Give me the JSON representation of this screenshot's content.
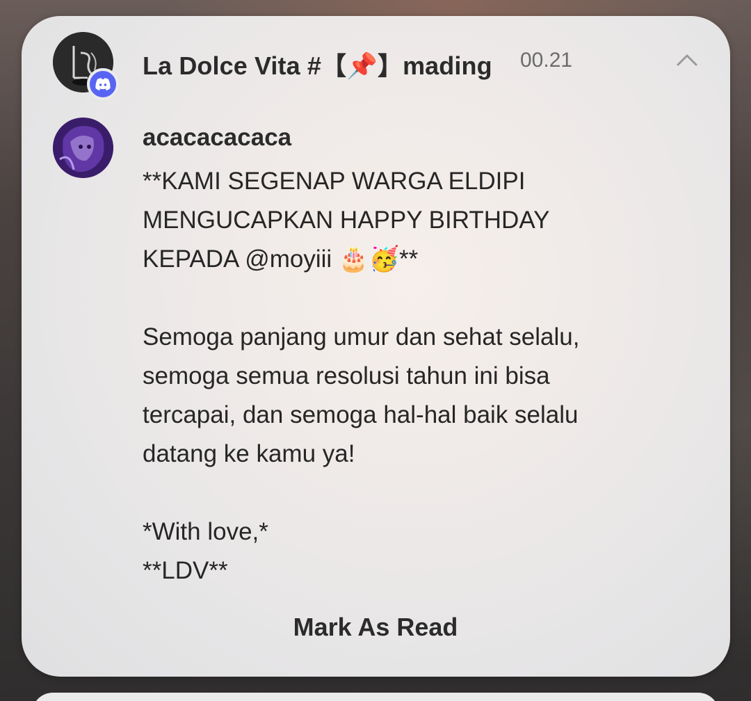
{
  "notification": {
    "server_name": "La Dolce Vita",
    "channel_separator": "#",
    "channel_name": "【📌】mading",
    "title_full": "La Dolce Vita #【📌】mading",
    "time": "00.21",
    "app_icon": "discord-icon",
    "collapse_icon": "chevron-up-icon",
    "server_avatar_text": "Ly",
    "author": "acacacacaca",
    "message_lines": [
      "**KAMI SEGENAP WARGA ELDIPI",
      "MENGUCAPKAN HAPPY BIRTHDAY",
      "KEPADA @moyiii 🎂🥳**",
      "",
      "Semoga panjang umur dan sehat selalu,",
      "semoga semua resolusi tahun ini bisa",
      "tercapai, dan semoga hal-hal baik selalu",
      "datang ke kamu ya!",
      "",
      "*With love,*",
      "**LDV**"
    ],
    "action_label": "Mark As Read"
  },
  "colors": {
    "discord_blurple": "#5865f2",
    "card_bg": "#ebebec",
    "text_primary": "#2b2b2b",
    "text_secondary": "#6b6b6b"
  }
}
